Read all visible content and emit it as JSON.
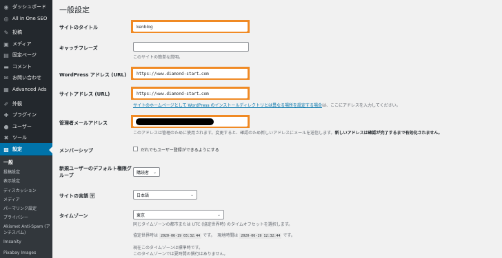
{
  "sidebar": {
    "items": [
      {
        "label": "ダッシュボード",
        "icon": "dashboard-icon",
        "glyph": "◉"
      },
      {
        "label": "All in One SEO",
        "icon": "seo-icon",
        "glyph": "◎"
      },
      {
        "label": "投稿",
        "icon": "pin-icon",
        "glyph": "✎"
      },
      {
        "label": "メディア",
        "icon": "media-icon",
        "glyph": "▣"
      },
      {
        "label": "固定ページ",
        "icon": "page-icon",
        "glyph": "▤"
      },
      {
        "label": "コメント",
        "icon": "comment-icon",
        "glyph": "▬"
      },
      {
        "label": "お問い合わせ",
        "icon": "mail-icon",
        "glyph": "✉"
      },
      {
        "label": "Advanced Ads",
        "icon": "ads-icon",
        "glyph": "▦"
      },
      {
        "label": "外観",
        "icon": "brush-icon",
        "glyph": "✐"
      },
      {
        "label": "プラグイン",
        "icon": "plugin-icon",
        "glyph": "✚"
      },
      {
        "label": "ユーザー",
        "icon": "user-icon",
        "glyph": "●"
      },
      {
        "label": "ツール",
        "icon": "wrench-icon",
        "glyph": "✖"
      },
      {
        "label": "設定",
        "icon": "settings-icon",
        "glyph": "▩"
      }
    ],
    "submenu": [
      "一般",
      "投稿設定",
      "表示設定",
      "ディスカッション",
      "メディア",
      "パーマリンク設定",
      "プライバシー",
      "Akismet Anti-Spam (アンチスパム)",
      "Imsanity",
      "Pixabay Images"
    ]
  },
  "page": {
    "title": "一般設定"
  },
  "form": {
    "site_title": {
      "label": "サイトのタイトル",
      "value": "kenblog"
    },
    "tagline": {
      "label": "キャッチフレーズ",
      "value": "",
      "desc": "このサイトの簡単な説明。"
    },
    "wp_address": {
      "label": "WordPress アドレス (URL)",
      "value": "https://www.diamond-start.com"
    },
    "site_address": {
      "label": "サイトアドレス (URL)",
      "value": "https://www.diamond-start.com",
      "desc_link": "サイトのホームページとして WordPress のインストールディレクトリとは異なる場所を設定する場合",
      "desc_rest": "は、ここにアドレスを入力してください。"
    },
    "admin_email": {
      "label": "管理者メールアドレス",
      "desc": "このアドレスは管理のために使用されます。変更すると、確認のため新しいアドレスにメールを送信します。",
      "desc_bold": "新しいアドレスは確認が完了するまで有効化されません。"
    },
    "membership": {
      "label": "メンバーシップ",
      "checkbox_label": "だれでもユーザー登録ができるようにする"
    },
    "default_role": {
      "label": "新規ユーザーのデフォルト権限グループ",
      "value": "購読者"
    },
    "language": {
      "label": "サイトの言語",
      "value": "日本語"
    },
    "timezone": {
      "label": "タイムゾーン",
      "value": "東京",
      "desc": "同じタイムゾーンの都市または UTC (協定世界時) のタイムオフセットを選択します。",
      "utc_label": "協定世界時は",
      "utc_time": "2020-06-19 03:32:44",
      "utc_suffix": "です。",
      "local_label": "現地時間は",
      "local_time": "2020-06-19 12:32:44",
      "local_suffix": "です。",
      "std_line1": "現在このタイムゾーンは標準時です。",
      "std_line2": "このタイムゾーンでは夏時間の慣行はありません。"
    }
  },
  "colors": {
    "highlight": "#f08a24",
    "sidebar": "#23282d",
    "accent": "#0073aa"
  }
}
